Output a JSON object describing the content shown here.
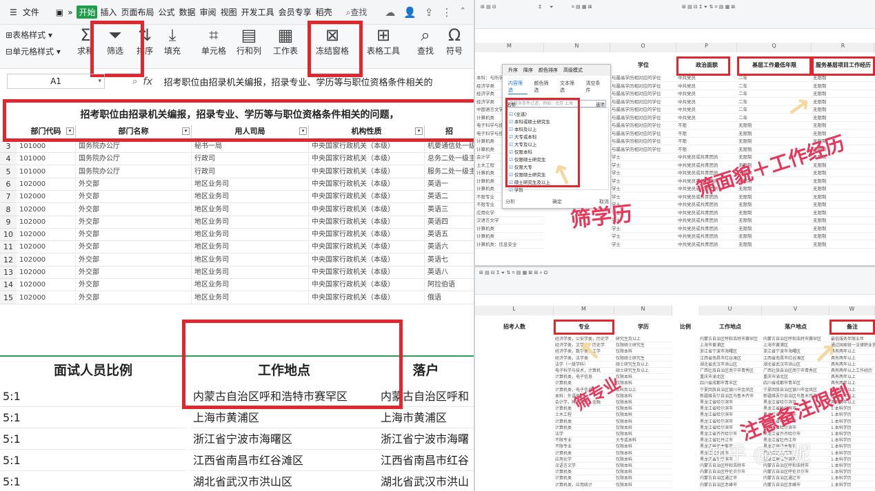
{
  "menu": {
    "file": "文件",
    "items": [
      "开始",
      "插入",
      "页面布局",
      "公式",
      "数据",
      "审阅",
      "视图",
      "开发工具",
      "会员专享",
      "稻壳"
    ],
    "active_index": 0,
    "search": "查找"
  },
  "ribbon": {
    "table_style": "表格样式",
    "cell_style": "单元格样式",
    "sum": "求和",
    "filter": "筛选",
    "sort": "排序",
    "fill": "填充",
    "cell": "单元格",
    "row_col": "行和列",
    "worksheet": "工作表",
    "freeze": "冻结窗格",
    "table_tools": "表格工具",
    "find": "查找",
    "symbol": "符号"
  },
  "formula_bar": {
    "cell_ref": "A1",
    "fx": "fx",
    "content": "招考职位由招录机关编报，招录专业、学历等与职位资格条件相关的"
  },
  "sheet": {
    "title": "招考职位由招录机关编报，招录专业、学历等与职位资格条件相关的问题，",
    "headers": [
      "部门代码",
      "部门名称",
      "用人司局",
      "机构性质",
      "招"
    ],
    "rows": [
      {
        "n": "3",
        "c": [
          "101000",
          "国务院办公厅",
          "秘书一局",
          "中央国家行政机关（本级）",
          "机要通信处一级"
        ]
      },
      {
        "n": "4",
        "c": [
          "101000",
          "国务院办公厅",
          "行政司",
          "中央国家行政机关（本级）",
          "总务二处一级主"
        ]
      },
      {
        "n": "5",
        "c": [
          "101000",
          "国务院办公厅",
          "行政司",
          "中央国家行政机关（本级）",
          "服务二处一级主"
        ]
      },
      {
        "n": "6",
        "c": [
          "102000",
          "外交部",
          "地区业务司",
          "中央国家行政机关（本级）",
          "英语一"
        ]
      },
      {
        "n": "7",
        "c": [
          "102000",
          "外交部",
          "地区业务司",
          "中央国家行政机关（本级）",
          "英语二"
        ]
      },
      {
        "n": "8",
        "c": [
          "102000",
          "外交部",
          "地区业务司",
          "中央国家行政机关（本级）",
          "英语三"
        ]
      },
      {
        "n": "9",
        "c": [
          "102000",
          "外交部",
          "地区业务司",
          "中央国家行政机关（本级）",
          "英语四"
        ]
      },
      {
        "n": "10",
        "c": [
          "102000",
          "外交部",
          "地区业务司",
          "中央国家行政机关（本级）",
          "英语五"
        ]
      },
      {
        "n": "11",
        "c": [
          "102000",
          "外交部",
          "地区业务司",
          "中央国家行政机关（本级）",
          "英语六"
        ]
      },
      {
        "n": "12",
        "c": [
          "102000",
          "外交部",
          "地区业务司",
          "中央国家行政机关（本级）",
          "英语七"
        ]
      },
      {
        "n": "13",
        "c": [
          "102000",
          "外交部",
          "地区业务司",
          "中央国家行政机关（本级）",
          "英语八"
        ]
      },
      {
        "n": "14",
        "c": [
          "102000",
          "外交部",
          "地区业务司",
          "中央国家行政机关（本级）",
          "阿拉伯语"
        ]
      },
      {
        "n": "15",
        "c": [
          "102000",
          "外交部",
          "地区业务司",
          "中央国家行政机关（本级）",
          "俄语"
        ]
      }
    ]
  },
  "lower": {
    "headers": [
      "面试人员比例",
      "工作地点",
      "落户"
    ],
    "rows": [
      [
        "5:1",
        "内蒙古自治区呼和浩特市赛罕区",
        "内蒙古自治区呼和"
      ],
      [
        "5:1",
        "上海市黄浦区",
        "上海市黄浦区"
      ],
      [
        "5:1",
        "浙江省宁波市海曙区",
        "浙江省宁波市海曙"
      ],
      [
        "5:1",
        "江西省南昌市红谷滩区",
        "江西省南昌市红谷"
      ],
      [
        "5:1",
        "湖北省武汉市洪山区",
        "湖北省武汉市洪山"
      ]
    ]
  },
  "right_top": {
    "cols": [
      "M",
      "N",
      "O",
      "P",
      "Q",
      "R"
    ],
    "headers": [
      "学位",
      "政治面貌",
      "基层工作最低年限",
      "服务基层项目工作经历"
    ],
    "dialog": {
      "toolbar": [
        "升序",
        "降序",
        "颜色排序",
        "高级模式"
      ],
      "tabs": [
        "内容筛选",
        "颜色筛选",
        "文本筛选",
        "清空条件"
      ],
      "search_placeholder": "支持多条件过滤，例如：北京 上海",
      "list_title": "名称",
      "options": "选项",
      "items": [
        "(全选)",
        "本科或硕士研究生",
        "本科及以上",
        "大专或本科",
        "大专及以上",
        "仅限本科",
        "仅限硕士研究生",
        "仅限大专",
        "仅限硕士研究生",
        "硕士研究生及以上",
        "学历"
      ],
      "analysis": "分析",
      "ok": "确定",
      "cancel": "取消"
    },
    "party_values": [
      "中共党员",
      "中共党员",
      "中共党员",
      "中共党员",
      "中共党员",
      "中共党员",
      "不限",
      "不限",
      "不限",
      "不限",
      "中共党员或共青团员",
      "中共党员或共青团员",
      "中共党员或共青团员",
      "中共党员或共青团员",
      "中共党员或共青团员",
      "中共党员或共青团员",
      "中共党员或共青团员",
      "中共党员或共青团员",
      "中共党员或共青团员",
      "中共党员或共青团员",
      "中共党员或共青团员",
      "中共党员或共青团员"
    ],
    "years_values": [
      "二年",
      "二年",
      "二年",
      "二年",
      "二年",
      "二年",
      "无限制",
      "无限制",
      "无限制",
      "无限制",
      "无限制",
      "无限制",
      "无限制",
      "无限制",
      "无限制",
      "无限制",
      "无限制",
      "无限制",
      "无限制",
      "无限制",
      "无限制",
      "无限制"
    ],
    "exp_values": [
      "无限制",
      "无限制",
      "无限制",
      "无限制",
      "无限制",
      "无限制",
      "无限制",
      "无限制",
      "无限制",
      "无限制",
      "无限制",
      "无限制",
      "无限制",
      "无限制",
      "无限制",
      "无限制",
      "无限制",
      "无限制",
      "无限制",
      "无限制",
      "无限制",
      "无限制"
    ],
    "degree_values": [
      "与最高学历相对应的学位",
      "与最高学历相对应的学位",
      "与最高学历相对应的学位",
      "与最高学历相对应的学位",
      "与最高学历相对应的学位",
      "与最高学历相对应的学位",
      "与最高学历相对应的学位",
      "与最高学历相对应的学位",
      "与最高学历相对应的学位",
      "与最高学历相对应的学位",
      "学士",
      "学士",
      "学士",
      "学士",
      "学士",
      "学士",
      "学士",
      "学士",
      "学士",
      "学士",
      "学士",
      "学士"
    ],
    "major_values": [
      "本科：与所学专业",
      "经济学类",
      "经济学类",
      "经济学类",
      "中国语言文学",
      "计算机类",
      "电子科学与技术",
      "电子科学与技术",
      "计算机类",
      "计算机类",
      "会计学",
      "土木工程",
      "计算机类",
      "计算机类",
      "计算机类",
      "不限专业",
      "不限专业",
      "应用化学",
      "汉语言文学",
      "计算机类",
      "计算机类",
      "计算机类：信息安全"
    ],
    "note_filter": "筛学历",
    "note_party": "筛面貌＋工作经历"
  },
  "right_bottom": {
    "cols": [
      "L",
      "M",
      "N",
      "U",
      "V",
      "W"
    ],
    "headers": [
      "招考人数",
      "专业",
      "学历",
      "比例",
      "工作地点",
      "落户地点",
      "备注"
    ],
    "major_values": [
      "经济学类，公安学类，历史学",
      "经济学类，文学类，历史学",
      "经济学类，数学类，工学",
      "经济学类，法学类",
      "法学（一级学科）",
      "电子科学与技术，计算机",
      "计算机类，电子信息",
      "计算机类",
      "计算机类，电子信息",
      "本科：外语类",
      "会计学，财务管理，金融",
      "计算机类",
      "土木工程",
      "计算机类",
      "计算机类",
      "法学",
      "不限专业",
      "不限专业",
      "计算机类",
      "应用化学",
      "汉语言文学",
      "计算机类",
      "计算机类",
      "计算机类，应用统计"
    ],
    "edu_values": [
      "研究生及以上",
      "仅限硕士研究生",
      "仅限本科",
      "仅限硕士研究生",
      "硕士研究生及以上",
      "硕士研究生及以上",
      "仅限本科",
      "仅限本科",
      "本科及以上",
      "仅限本科",
      "仅限本科",
      "仅限本科",
      "仅限本科",
      "仅限本科",
      "仅限本科",
      "仅限本科",
      "大专或本科",
      "仅限本科",
      "仅限本科",
      "仅限本科",
      "仅限本科",
      "仅限本科",
      "仅限本科",
      "仅限本科"
    ],
    "place_values": [
      "内蒙古自治区呼和浩特市赛罕区",
      "上海市黄浦区",
      "浙江省宁波市海曙区",
      "江西省南昌市红谷滩区",
      "湖北省武汉市洪山区",
      "广西壮族自治区南宁市青秀区",
      "重庆市渝北区",
      "四川省成都市青羊区",
      "宁夏回族自治区银川市金凤区",
      "新疆维吾尔自治区乌鲁木齐市",
      "黑龙江省哈尔滨市",
      "黑龙江省哈尔滨市",
      "黑龙江省哈尔滨市",
      "黑龙江省哈尔滨市",
      "黑龙江省哈尔滨市",
      "黑龙江省齐齐哈尔市",
      "黑龙江省牡丹江市",
      "黑龙江省佳木斯市",
      "黑龙江省大庆市",
      "黑龙江省哈尔滨市",
      "内蒙古自治区呼和浩特市",
      "内蒙古自治区呼伦贝尔市",
      "内蒙古自治区通辽市",
      "内蒙古自治区赤峰市"
    ],
    "notes": [
      "最低服务年限五年",
      "通过国家统一法律职业资格考试",
      "具有两年以上",
      "具有两年以上",
      "具有两年以上",
      "具有两年以上工作经历",
      "具有两年以上",
      "具有两年以上",
      "具有两年以上",
      "具有两年以上",
      "具有两年以上",
      "1.本科学历",
      "1.本科学历",
      "1.本科学历",
      "1.本科学历",
      "1.本科学历",
      "1.本科学历",
      "1.本科学历",
      "1.本科学历",
      "1.本科学历",
      "1.本科学历",
      "1.本科学历",
      "1.本科学历",
      "1.本科学历"
    ],
    "note_major": "筛专业",
    "note_remark": "注意备注限制",
    "watermark": "知乎 @安妮"
  }
}
